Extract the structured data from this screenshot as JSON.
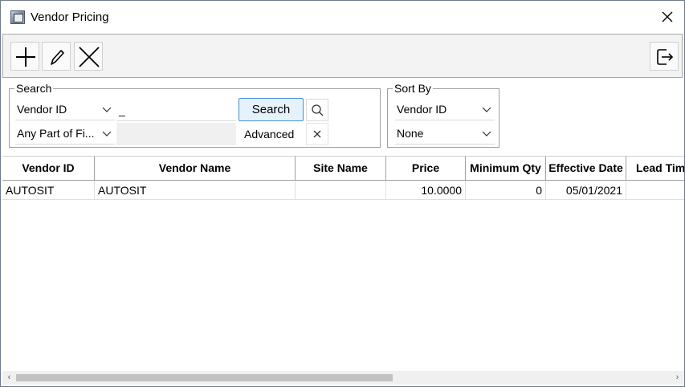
{
  "window": {
    "title": "Vendor Pricing"
  },
  "toolbar": {
    "add_icon": "plus-icon",
    "edit_icon": "pencil-icon",
    "delete_icon": "x-icon",
    "exit_icon": "exit-icon"
  },
  "search": {
    "legend": "Search",
    "field_select": "Vendor ID",
    "match_select": "Any Part of Fi...",
    "query_value": "_",
    "search_button": "Search",
    "advanced_label": "Advanced"
  },
  "sort": {
    "legend": "Sort By",
    "primary": "Vendor ID",
    "secondary": "None"
  },
  "grid": {
    "columns": [
      "Vendor ID",
      "Vendor Name",
      "Site Name",
      "Price",
      "Minimum Qty",
      "Effective Date",
      "Lead Time"
    ],
    "rows": [
      [
        "AUTOSIT",
        "AUTOSIT",
        "",
        "10.0000",
        "0",
        "05/01/2021",
        ""
      ]
    ]
  }
}
